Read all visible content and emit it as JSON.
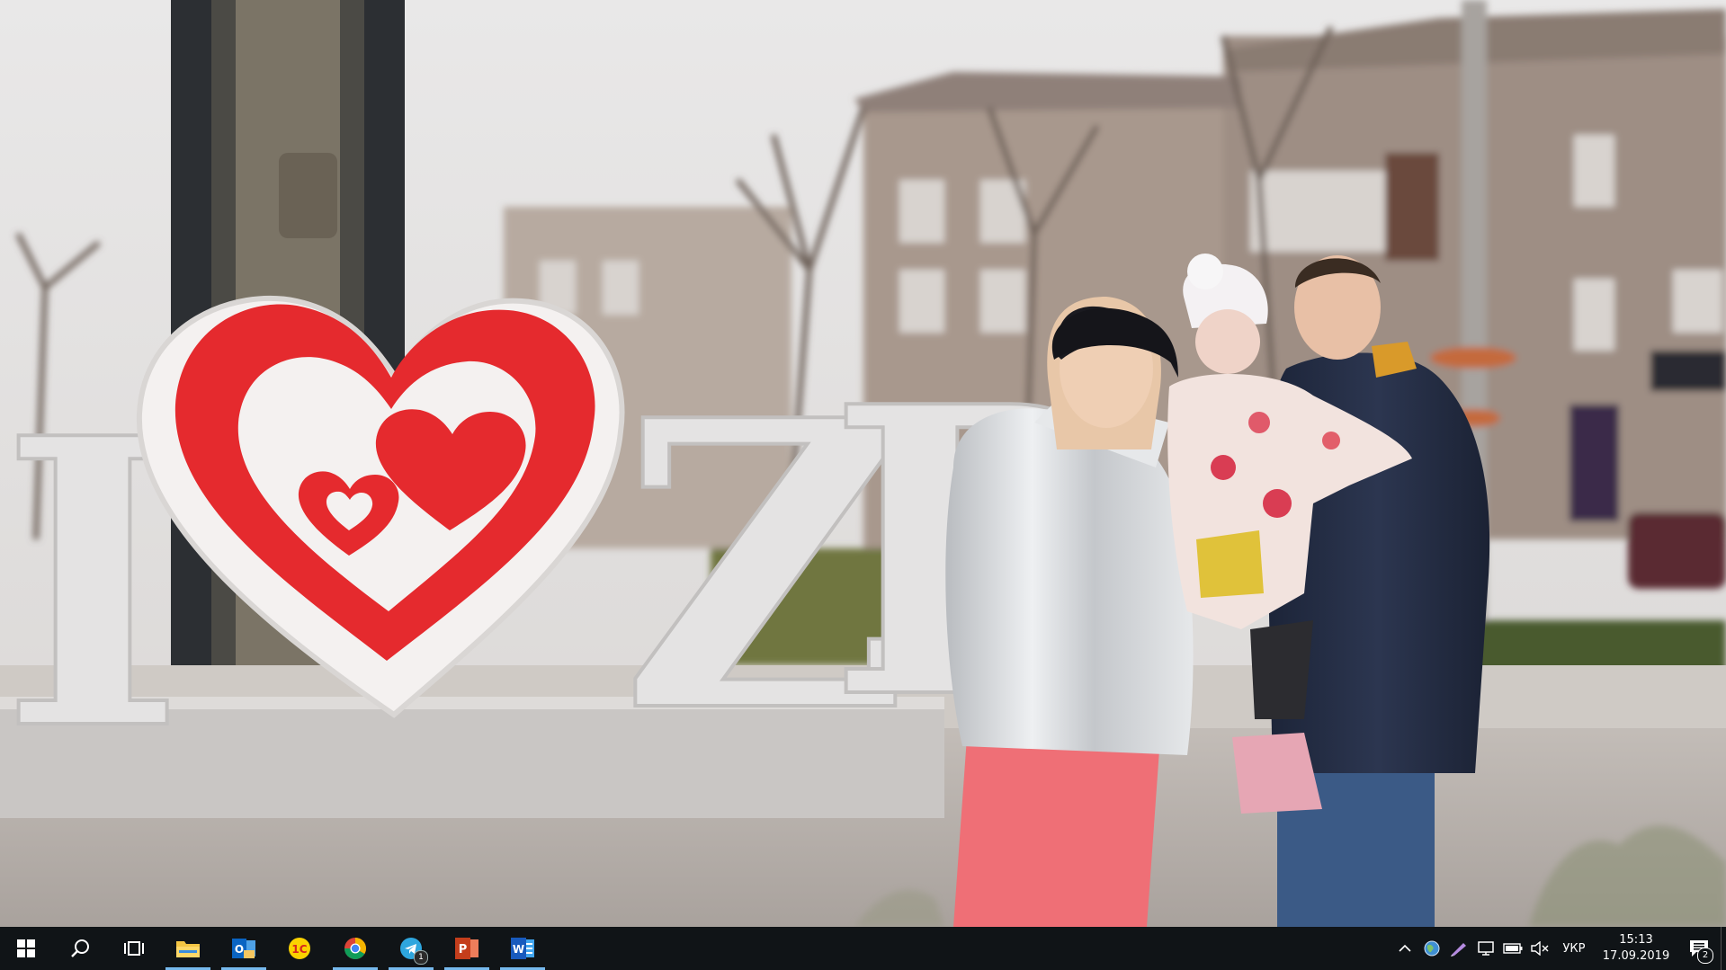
{
  "wallpaper": {
    "sign_letters": [
      "I",
      "Z",
      "P"
    ]
  },
  "taskbar": {
    "background": "#101417",
    "accent": "#76b9ed",
    "start_icon": "windows-start-icon",
    "search_icon": "search-icon",
    "task_view_icon": "task-view-icon",
    "pinned_apps": [
      {
        "name": "File Explorer",
        "icon": "file-explorer-icon",
        "active": true
      },
      {
        "name": "Outlook",
        "icon": "outlook-icon",
        "active": true
      },
      {
        "name": "1C",
        "icon": "1c-icon",
        "active": false
      },
      {
        "name": "Google Chrome",
        "icon": "chrome-icon",
        "active": true
      },
      {
        "name": "Telegram",
        "icon": "telegram-icon",
        "active": true,
        "badge": "1"
      },
      {
        "name": "PowerPoint",
        "icon": "powerpoint-icon",
        "active": true
      },
      {
        "name": "Word",
        "icon": "word-icon",
        "active": true
      }
    ],
    "tray": {
      "icons": [
        "chevron-up-icon",
        "network-globe-icon",
        "pen-icon",
        "display-icon",
        "battery-icon",
        "volume-muted-icon"
      ],
      "language": "УКР",
      "time": "15:13",
      "date": "17.09.2019",
      "notification_count": "2"
    }
  }
}
